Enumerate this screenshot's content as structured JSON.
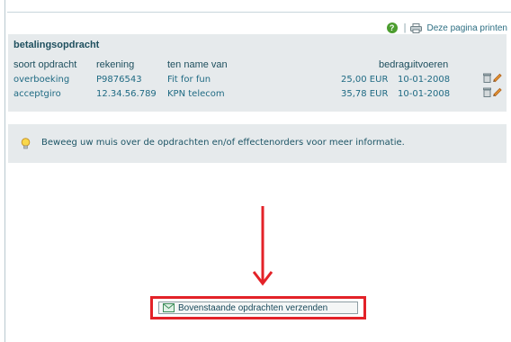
{
  "toolbar": {
    "help_icon": "help-icon",
    "separator": "|",
    "print_icon": "printer-icon",
    "print_label": "Deze pagina printen"
  },
  "panel": {
    "title": "betalingsopdracht",
    "columns": {
      "type": "soort opdracht",
      "account": "rekening",
      "name": "ten name van",
      "amount": "bedrag",
      "execute": "uitvoeren"
    },
    "rows": [
      {
        "type": "overboeking",
        "account": "P9876543",
        "name": "Fit for fun",
        "amount": "25,00 EUR",
        "date": "10-01-2008",
        "delete_icon": "trash-icon",
        "edit_icon": "pencil-icon"
      },
      {
        "type": "acceptgiro",
        "account": "12.34.56.789",
        "name": "KPN telecom",
        "amount": "35,78 EUR",
        "date": "10-01-2008",
        "delete_icon": "trash-icon",
        "edit_icon": "pencil-icon"
      }
    ]
  },
  "info": {
    "icon": "lightbulb-icon",
    "text": "Beweeg uw muis over de opdrachten en/of effectenorders voor meer informatie."
  },
  "send": {
    "icon": "envelope-icon",
    "label": "Bovenstaande opdrachten verzenden"
  },
  "colors": {
    "accent_text": "#1f6a83",
    "panel_background": "#e6eaec",
    "highlight_border": "#e32228",
    "arrow": "#e32228"
  }
}
